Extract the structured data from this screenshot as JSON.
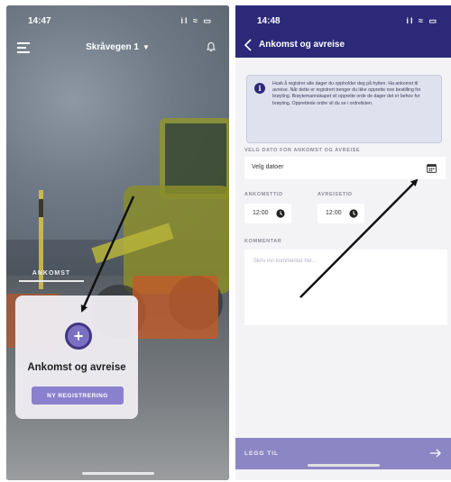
{
  "left_screen": {
    "status_time": "14:47",
    "status_icons": "il ≈ ▭",
    "location_title": "Skråvegen 1",
    "tab_label": "ANKOMST",
    "card": {
      "add_symbol": "+",
      "title": "Ankomst og avreise",
      "button_label": "NY REGISTRERING"
    },
    "icons": [
      "menu-icon",
      "chevron-down-icon",
      "bell-icon",
      "plus-icon"
    ]
  },
  "right_screen": {
    "status_time": "14:48",
    "status_icons": "il ≈ ▭",
    "page_title": "Ankomst og avreise",
    "info_text": "Husk å registrer alle dager du oppholder deg på hytten. Ha ankomst til avreise. Når dette er registrert trenger du ikke opprette noe bestilling for brøyting. Brøytemannskapet vil opprette orde de dager det er behov for brøyting. Opprettede ordre vil du se i ordrelisten.",
    "date_section_label": "VELG DATO FOR ANKOMST OG AVREISE",
    "date_placeholder": "Velg datoer",
    "arrival_time_label": "ANKOMSTTID",
    "arrival_time_value": "12:00",
    "departure_time_label": "AVREISETID",
    "departure_time_value": "12:00",
    "comment_label": "KOMMENTAR",
    "comment_placeholder": "Skriv inn kommentar her...",
    "submit_label": "LEGG TIL",
    "icons": [
      "back-icon",
      "info-icon",
      "calendar-icon",
      "clock-icon",
      "arrow-right-icon"
    ]
  },
  "colors": {
    "header_navy": "#2c2a78",
    "accent_purple": "#8a80cd",
    "submit_bar": "#8d86c4",
    "info_bg": "#dfe1ef"
  }
}
